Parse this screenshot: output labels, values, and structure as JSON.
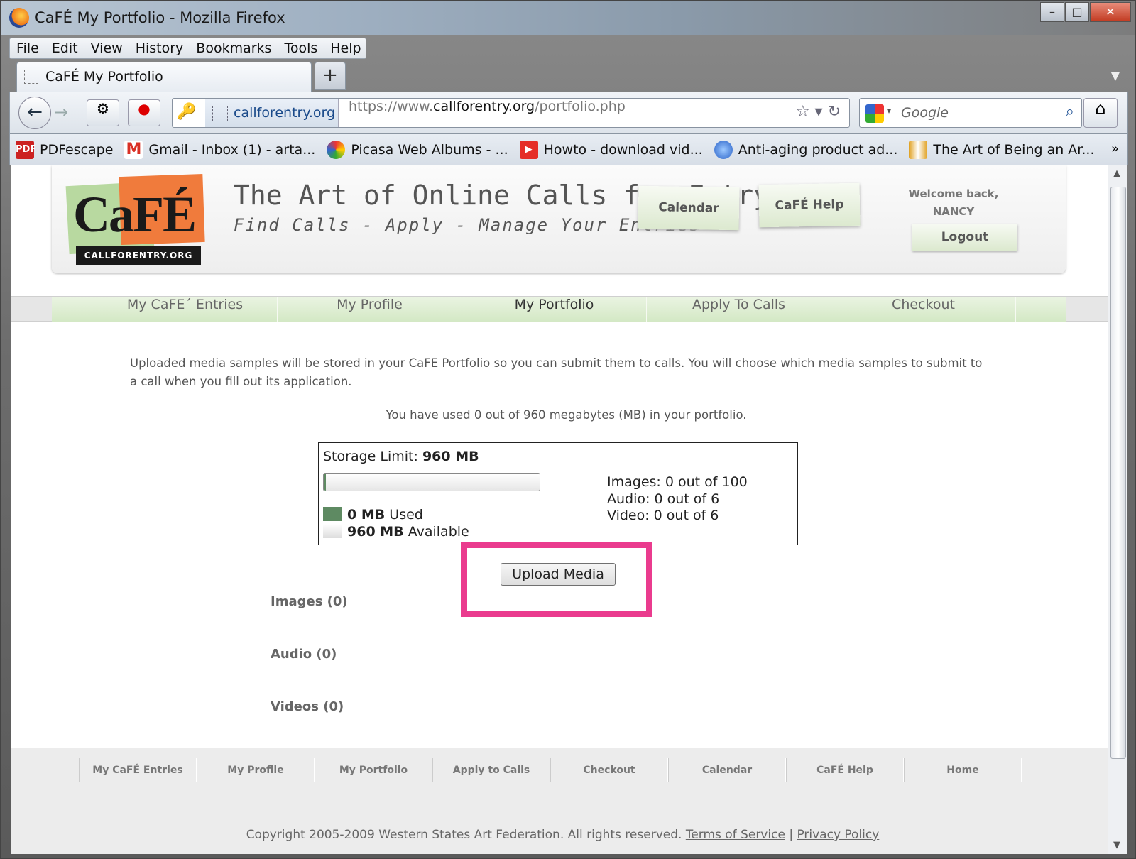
{
  "window": {
    "title": "CaFÉ My Portfolio - Mozilla Firefox"
  },
  "menu": [
    "File",
    "Edit",
    "View",
    "History",
    "Bookmarks",
    "Tools",
    "Help"
  ],
  "tab": {
    "title": "CaFÉ My Portfolio",
    "new_tab": "+"
  },
  "address": {
    "site": "callforentry.org",
    "url_prefix": "https://www.",
    "url_domain": "callforentry.org",
    "url_path": "/portfolio.php"
  },
  "search": {
    "placeholder": "Google"
  },
  "bookmarks": [
    {
      "label": "PDFescape",
      "icon": "pdf-icon",
      "color": "#cc2222"
    },
    {
      "label": "Gmail - Inbox (1) - arta...",
      "icon": "gmail-icon",
      "color": "#d93025"
    },
    {
      "label": "Picasa Web Albums - ...",
      "icon": "picasa-icon",
      "color": "#3b7dd8"
    },
    {
      "label": "Howto - download vid...",
      "icon": "youtube-icon",
      "color": "#e52d27"
    },
    {
      "label": "Anti-aging product ad...",
      "icon": "globe-icon",
      "color": "#2a62c8"
    },
    {
      "label": "The Art of Being an Ar...",
      "icon": "bookmark-icon",
      "color": "#e0a020"
    }
  ],
  "header": {
    "logo_word": "CaFÉ",
    "logo_sub": "CALLFORENTRY.ORG",
    "tagline": "The Art of Online Calls for Entry",
    "subtagline": "Find Calls - Apply - Manage Your Entries",
    "calendar": "Calendar",
    "help": "CaFÉ Help",
    "welcome": "Welcome back,",
    "user": "NANCY",
    "logout": "Logout"
  },
  "nav": [
    "My CaFE´ Entries",
    "My Profile",
    "My Portfolio",
    "Apply To Calls",
    "Checkout"
  ],
  "intro": "Uploaded media samples will be stored in your CaFE Portfolio so you can submit them to calls. You will choose which media samples to submit to a call when you fill out its application.",
  "usage": "You have used 0 out of 960 megabytes (MB) in your portfolio.",
  "storage": {
    "limit_label": "Storage Limit:",
    "limit_value": "960 MB",
    "used_fraction": 0,
    "used_value": "0 MB",
    "used_label": "Used",
    "available_value": "960 MB",
    "available_label": "Available",
    "images": "Images: 0 out of 100",
    "audio": "Audio: 0 out of 6",
    "video": "Video: 0 out of 6",
    "used_color": "#5e8a62"
  },
  "upload_button": "Upload Media",
  "highlight_color": "#ea3b8e",
  "sections": {
    "images": "Images (0)",
    "audio": "Audio (0)",
    "videos": "Videos (0)"
  },
  "footer": {
    "links": [
      "My CaFÉ Entries",
      "My Profile",
      "My Portfolio",
      "Apply to Calls",
      "Checkout",
      "Calendar",
      "CaFÉ Help",
      "Home"
    ],
    "copyright": "Copyright 2005-2009 Western States Art Federation. All rights reserved.",
    "terms": "Terms of Service",
    "sep": "|",
    "privacy": "Privacy Policy"
  }
}
